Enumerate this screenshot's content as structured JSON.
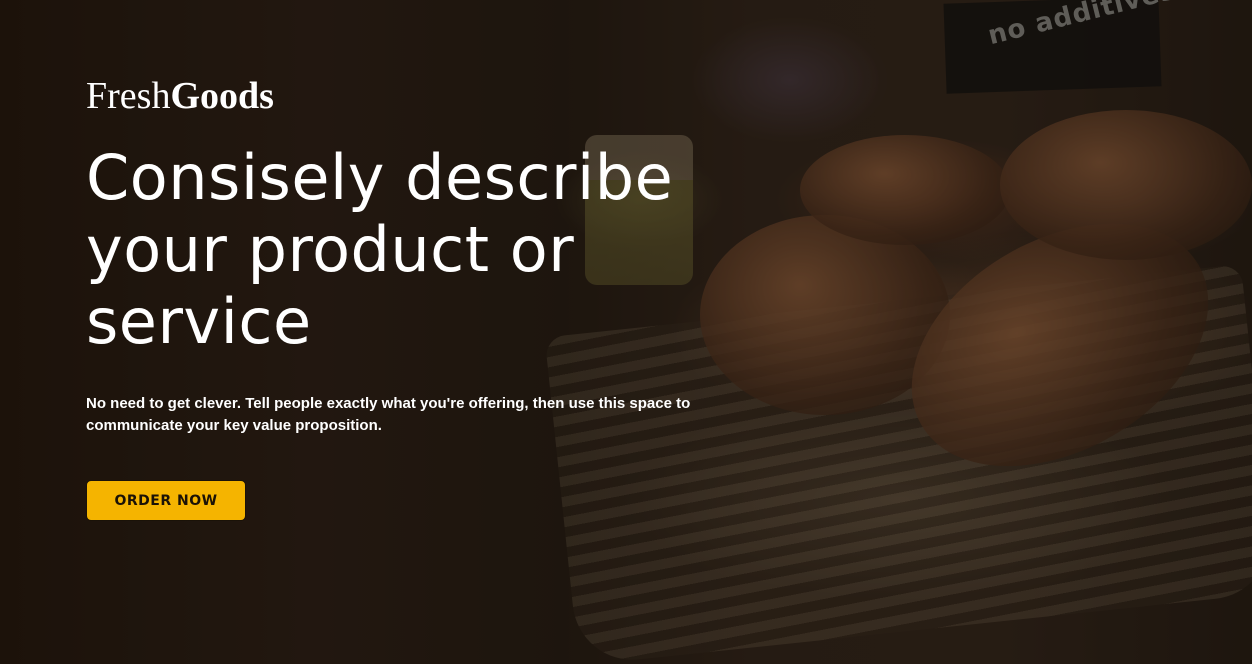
{
  "brand": {
    "name_regular": "Fresh",
    "name_bold": "Goods"
  },
  "hero": {
    "headline": "Consisely describe your product or service",
    "subtext": "No need to get clever. Tell people exactly what you're offering, then use this space to communicate your key value proposition.",
    "cta_label": "ORDER NOW",
    "background_sign_text": "no additives"
  },
  "colors": {
    "cta_background": "#f5b400",
    "cta_text": "#1b1206",
    "text": "#ffffff",
    "overlay": "#0a0603"
  }
}
